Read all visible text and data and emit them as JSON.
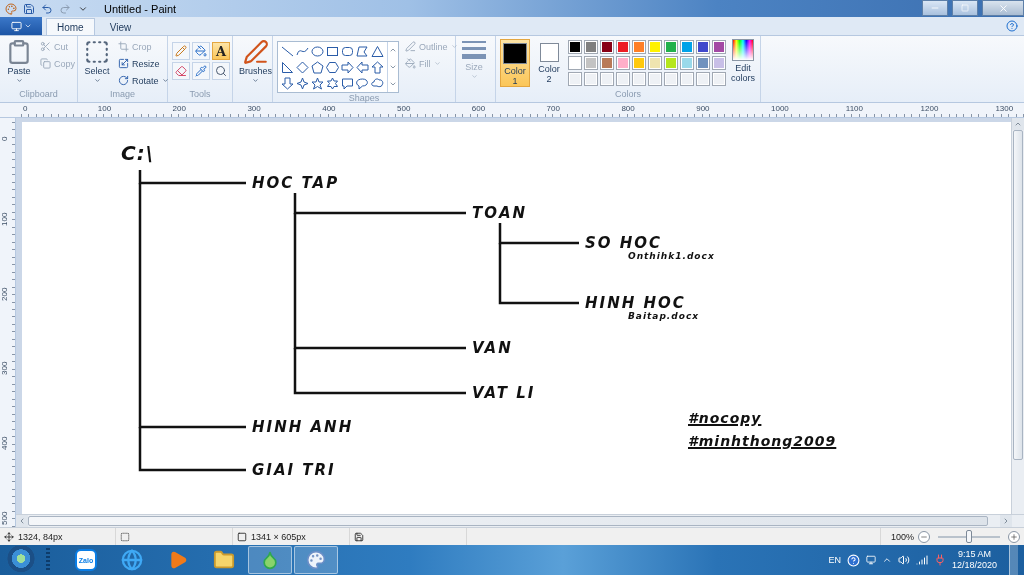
{
  "window": {
    "title": "Untitled - Paint"
  },
  "tabs": [
    {
      "label": "Home",
      "selected": true
    },
    {
      "label": "View",
      "selected": false
    }
  ],
  "ribbon": {
    "clipboard": {
      "label": "Clipboard",
      "paste": "Paste",
      "cut": {
        "label": "Cut",
        "disabled": true
      },
      "copy": {
        "label": "Copy",
        "disabled": true
      }
    },
    "image": {
      "label": "Image",
      "select": "Select",
      "crop": {
        "label": "Crop",
        "disabled": true
      },
      "resize": "Resize",
      "rotate": "Rotate"
    },
    "tools": {
      "label": "Tools",
      "items": [
        {
          "kind": "pencil",
          "selected": false
        },
        {
          "kind": "fill",
          "selected": false
        },
        {
          "kind": "text",
          "glyph": "A",
          "selected": true
        },
        {
          "kind": "eraser",
          "selected": false
        },
        {
          "kind": "picker",
          "selected": false
        },
        {
          "kind": "magnifier",
          "selected": false
        }
      ]
    },
    "brushes": {
      "label": "Brushes"
    },
    "shapes": {
      "label": "Shapes",
      "outline": {
        "label": "Outline",
        "disabled": true
      },
      "fill": {
        "label": "Fill",
        "disabled": true
      }
    },
    "size": {
      "label": "Size",
      "disabled": true
    },
    "colors": {
      "label": "Colors",
      "edit": "Edit colors",
      "active": [
        {
          "label": "Color 1",
          "color": "#000000",
          "selected": true
        },
        {
          "label": "Color 2",
          "color": "#ffffff",
          "selected": false
        }
      ],
      "palette": [
        {
          "color": "#000000"
        },
        {
          "color": "#7f7f7f"
        },
        {
          "color": "#880015"
        },
        {
          "color": "#ed1c24"
        },
        {
          "color": "#ff7f27"
        },
        {
          "color": "#fff200"
        },
        {
          "color": "#22b14c"
        },
        {
          "color": "#00a2e8"
        },
        {
          "color": "#3f48cc"
        },
        {
          "color": "#a349a4"
        },
        {
          "color": "#ffffff"
        },
        {
          "color": "#c3c3c3"
        },
        {
          "color": "#b97a57"
        },
        {
          "color": "#ffaec9"
        },
        {
          "color": "#ffc90e"
        },
        {
          "color": "#efe4b0"
        },
        {
          "color": "#b5e61d"
        },
        {
          "color": "#99d9ea"
        },
        {
          "color": "#7092be"
        },
        {
          "color": "#c8bfe7"
        }
      ]
    }
  },
  "rulers": {
    "x_labels": [
      "0",
      "100",
      "200",
      "300",
      "400",
      "500",
      "600",
      "700",
      "800",
      "900",
      "1000",
      "1100",
      "1200",
      "1300"
    ],
    "y_labels": [
      "0",
      "100",
      "200",
      "300",
      "400",
      "500"
    ]
  },
  "canvas": {
    "tree": {
      "label": "C:\\",
      "children": [
        {
          "label": "HOC TAP",
          "children": [
            {
              "label": "TOAN",
              "children": [
                {
                  "label": "SO HOC",
                  "file": "Onthihk1.docx"
                },
                {
                  "label": "HINH HOC",
                  "file": "Baitap.docx"
                }
              ]
            },
            {
              "label": "VAN"
            },
            {
              "label": "VAT LI"
            }
          ]
        },
        {
          "label": "HINH ANH"
        },
        {
          "label": "GIAI TRI"
        }
      ]
    },
    "tags": [
      "#nocopy",
      "#minhthong2009"
    ]
  },
  "status_bar": {
    "cursor": "1324, 84px",
    "size": "1341 × 605px",
    "zoom": "100%",
    "zoom_slider": {
      "level": 0.5
    }
  },
  "taskbar": {
    "apps": [
      {
        "kind": "zalo",
        "label": "Zalo",
        "running": false
      },
      {
        "kind": "browser",
        "running": false
      },
      {
        "kind": "media",
        "running": false
      },
      {
        "kind": "folder",
        "running": false
      },
      {
        "kind": "coccoc",
        "running": true
      },
      {
        "kind": "paint",
        "running": true
      }
    ],
    "tray": {
      "language": "EN",
      "time": "9:15 AM",
      "date": "12/18/2020"
    }
  }
}
